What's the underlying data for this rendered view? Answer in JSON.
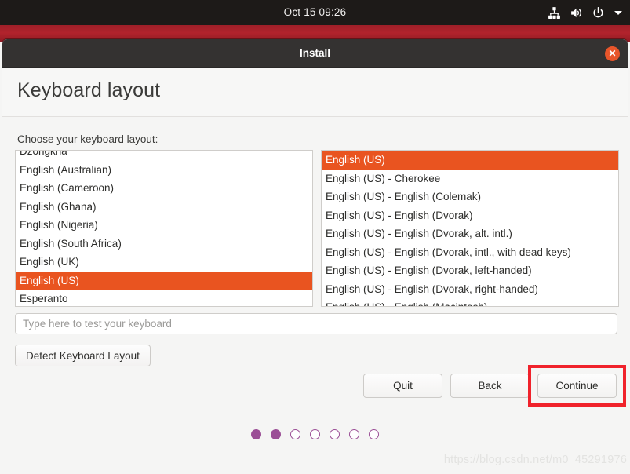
{
  "topbar": {
    "clock": "Oct 15  09:26",
    "icons": [
      "network-icon",
      "volume-icon",
      "power-icon",
      "chevron-down-icon"
    ]
  },
  "window": {
    "title": "Install",
    "close_label": "✕"
  },
  "page": {
    "title": "Keyboard layout",
    "choose_label": "Choose your keyboard layout:"
  },
  "layout_list": {
    "selected": "English (US)",
    "items": [
      "Dzongkha",
      "English (Australian)",
      "English (Cameroon)",
      "English (Ghana)",
      "English (Nigeria)",
      "English (South Africa)",
      "English (UK)",
      "English (US)",
      "Esperanto"
    ]
  },
  "variant_list": {
    "selected": "English (US)",
    "items": [
      "English (US)",
      "English (US) - Cherokee",
      "English (US) - English (Colemak)",
      "English (US) - English (Dvorak)",
      "English (US) - English (Dvorak, alt. intl.)",
      "English (US) - English (Dvorak, intl., with dead keys)",
      "English (US) - English (Dvorak, left-handed)",
      "English (US) - English (Dvorak, right-handed)",
      "English (US) - English (Macintosh)"
    ]
  },
  "test_input": {
    "value": "",
    "placeholder": "Type here to test your keyboard"
  },
  "detect_button": {
    "label": "Detect Keyboard Layout"
  },
  "nav": {
    "quit": "Quit",
    "back": "Back",
    "continue": "Continue"
  },
  "progress_dots": {
    "total": 7,
    "filled": 2
  },
  "watermark": "https://blog.csdn.net/m0_45291976",
  "colors": {
    "accent_orange": "#e95420",
    "dot_purple": "#9b4f96",
    "highlight_red": "#f0222b",
    "titlebar": "#343231",
    "desktop_red": "#b2232c"
  }
}
